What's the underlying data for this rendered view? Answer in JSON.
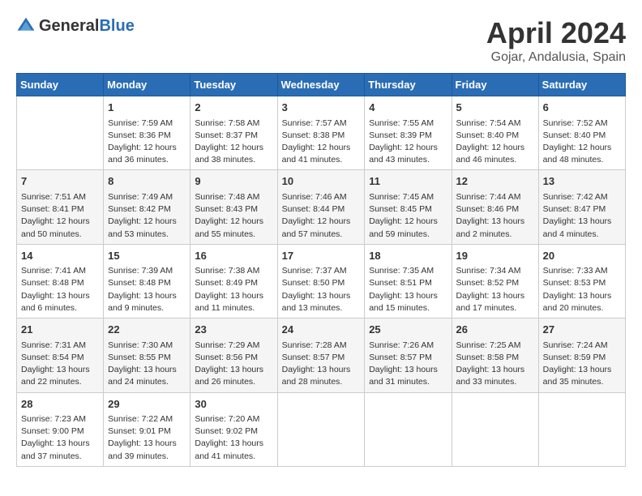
{
  "header": {
    "logo_general": "General",
    "logo_blue": "Blue",
    "month_title": "April 2024",
    "location": "Gojar, Andalusia, Spain"
  },
  "days_of_week": [
    "Sunday",
    "Monday",
    "Tuesday",
    "Wednesday",
    "Thursday",
    "Friday",
    "Saturday"
  ],
  "weeks": [
    [
      {
        "day": "",
        "sunrise": "",
        "sunset": "",
        "daylight": ""
      },
      {
        "day": "1",
        "sunrise": "Sunrise: 7:59 AM",
        "sunset": "Sunset: 8:36 PM",
        "daylight": "Daylight: 12 hours and 36 minutes."
      },
      {
        "day": "2",
        "sunrise": "Sunrise: 7:58 AM",
        "sunset": "Sunset: 8:37 PM",
        "daylight": "Daylight: 12 hours and 38 minutes."
      },
      {
        "day": "3",
        "sunrise": "Sunrise: 7:57 AM",
        "sunset": "Sunset: 8:38 PM",
        "daylight": "Daylight: 12 hours and 41 minutes."
      },
      {
        "day": "4",
        "sunrise": "Sunrise: 7:55 AM",
        "sunset": "Sunset: 8:39 PM",
        "daylight": "Daylight: 12 hours and 43 minutes."
      },
      {
        "day": "5",
        "sunrise": "Sunrise: 7:54 AM",
        "sunset": "Sunset: 8:40 PM",
        "daylight": "Daylight: 12 hours and 46 minutes."
      },
      {
        "day": "6",
        "sunrise": "Sunrise: 7:52 AM",
        "sunset": "Sunset: 8:40 PM",
        "daylight": "Daylight: 12 hours and 48 minutes."
      }
    ],
    [
      {
        "day": "7",
        "sunrise": "Sunrise: 7:51 AM",
        "sunset": "Sunset: 8:41 PM",
        "daylight": "Daylight: 12 hours and 50 minutes."
      },
      {
        "day": "8",
        "sunrise": "Sunrise: 7:49 AM",
        "sunset": "Sunset: 8:42 PM",
        "daylight": "Daylight: 12 hours and 53 minutes."
      },
      {
        "day": "9",
        "sunrise": "Sunrise: 7:48 AM",
        "sunset": "Sunset: 8:43 PM",
        "daylight": "Daylight: 12 hours and 55 minutes."
      },
      {
        "day": "10",
        "sunrise": "Sunrise: 7:46 AM",
        "sunset": "Sunset: 8:44 PM",
        "daylight": "Daylight: 12 hours and 57 minutes."
      },
      {
        "day": "11",
        "sunrise": "Sunrise: 7:45 AM",
        "sunset": "Sunset: 8:45 PM",
        "daylight": "Daylight: 12 hours and 59 minutes."
      },
      {
        "day": "12",
        "sunrise": "Sunrise: 7:44 AM",
        "sunset": "Sunset: 8:46 PM",
        "daylight": "Daylight: 13 hours and 2 minutes."
      },
      {
        "day": "13",
        "sunrise": "Sunrise: 7:42 AM",
        "sunset": "Sunset: 8:47 PM",
        "daylight": "Daylight: 13 hours and 4 minutes."
      }
    ],
    [
      {
        "day": "14",
        "sunrise": "Sunrise: 7:41 AM",
        "sunset": "Sunset: 8:48 PM",
        "daylight": "Daylight: 13 hours and 6 minutes."
      },
      {
        "day": "15",
        "sunrise": "Sunrise: 7:39 AM",
        "sunset": "Sunset: 8:48 PM",
        "daylight": "Daylight: 13 hours and 9 minutes."
      },
      {
        "day": "16",
        "sunrise": "Sunrise: 7:38 AM",
        "sunset": "Sunset: 8:49 PM",
        "daylight": "Daylight: 13 hours and 11 minutes."
      },
      {
        "day": "17",
        "sunrise": "Sunrise: 7:37 AM",
        "sunset": "Sunset: 8:50 PM",
        "daylight": "Daylight: 13 hours and 13 minutes."
      },
      {
        "day": "18",
        "sunrise": "Sunrise: 7:35 AM",
        "sunset": "Sunset: 8:51 PM",
        "daylight": "Daylight: 13 hours and 15 minutes."
      },
      {
        "day": "19",
        "sunrise": "Sunrise: 7:34 AM",
        "sunset": "Sunset: 8:52 PM",
        "daylight": "Daylight: 13 hours and 17 minutes."
      },
      {
        "day": "20",
        "sunrise": "Sunrise: 7:33 AM",
        "sunset": "Sunset: 8:53 PM",
        "daylight": "Daylight: 13 hours and 20 minutes."
      }
    ],
    [
      {
        "day": "21",
        "sunrise": "Sunrise: 7:31 AM",
        "sunset": "Sunset: 8:54 PM",
        "daylight": "Daylight: 13 hours and 22 minutes."
      },
      {
        "day": "22",
        "sunrise": "Sunrise: 7:30 AM",
        "sunset": "Sunset: 8:55 PM",
        "daylight": "Daylight: 13 hours and 24 minutes."
      },
      {
        "day": "23",
        "sunrise": "Sunrise: 7:29 AM",
        "sunset": "Sunset: 8:56 PM",
        "daylight": "Daylight: 13 hours and 26 minutes."
      },
      {
        "day": "24",
        "sunrise": "Sunrise: 7:28 AM",
        "sunset": "Sunset: 8:57 PM",
        "daylight": "Daylight: 13 hours and 28 minutes."
      },
      {
        "day": "25",
        "sunrise": "Sunrise: 7:26 AM",
        "sunset": "Sunset: 8:57 PM",
        "daylight": "Daylight: 13 hours and 31 minutes."
      },
      {
        "day": "26",
        "sunrise": "Sunrise: 7:25 AM",
        "sunset": "Sunset: 8:58 PM",
        "daylight": "Daylight: 13 hours and 33 minutes."
      },
      {
        "day": "27",
        "sunrise": "Sunrise: 7:24 AM",
        "sunset": "Sunset: 8:59 PM",
        "daylight": "Daylight: 13 hours and 35 minutes."
      }
    ],
    [
      {
        "day": "28",
        "sunrise": "Sunrise: 7:23 AM",
        "sunset": "Sunset: 9:00 PM",
        "daylight": "Daylight: 13 hours and 37 minutes."
      },
      {
        "day": "29",
        "sunrise": "Sunrise: 7:22 AM",
        "sunset": "Sunset: 9:01 PM",
        "daylight": "Daylight: 13 hours and 39 minutes."
      },
      {
        "day": "30",
        "sunrise": "Sunrise: 7:20 AM",
        "sunset": "Sunset: 9:02 PM",
        "daylight": "Daylight: 13 hours and 41 minutes."
      },
      {
        "day": "",
        "sunrise": "",
        "sunset": "",
        "daylight": ""
      },
      {
        "day": "",
        "sunrise": "",
        "sunset": "",
        "daylight": ""
      },
      {
        "day": "",
        "sunrise": "",
        "sunset": "",
        "daylight": ""
      },
      {
        "day": "",
        "sunrise": "",
        "sunset": "",
        "daylight": ""
      }
    ]
  ]
}
